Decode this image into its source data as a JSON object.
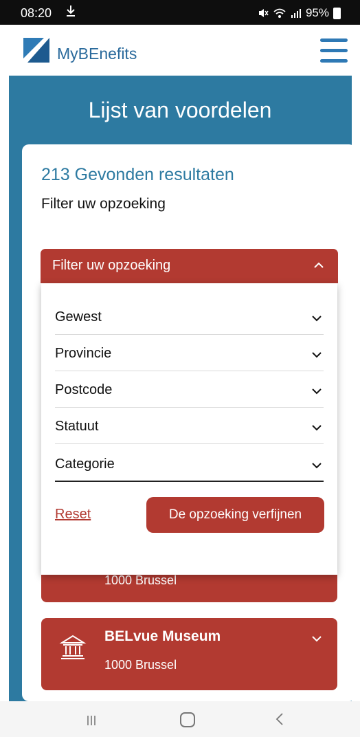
{
  "status_bar": {
    "time": "08:20",
    "download_icon": "download-icon",
    "battery": "95%",
    "icons": [
      "mute-icon",
      "wifi-icon",
      "signal-icon",
      "battery-icon"
    ]
  },
  "header": {
    "brand": "MyBEnefits",
    "logo_icon": "mybenefits-logo",
    "menu_icon": "hamburger-menu-icon"
  },
  "page": {
    "title": "Lijst van voordelen",
    "results_count": "213 Gevonden resultaten",
    "subtitle": "Filter uw opzoeking"
  },
  "filter": {
    "header_label": "Filter uw opzoeking",
    "expanded": true,
    "fields": [
      {
        "label": "Gewest"
      },
      {
        "label": "Provincie"
      },
      {
        "label": "Postcode"
      },
      {
        "label": "Statuut"
      },
      {
        "label": "Categorie"
      }
    ],
    "reset_label": "Reset",
    "refine_label": "De opzoeking verfijnen"
  },
  "results": [
    {
      "title": "",
      "city": "1000 Brussel"
    },
    {
      "title": "BELvue Museum",
      "city": "1000 Brussel",
      "icon": "museum-icon"
    }
  ],
  "nav": {
    "recent_icon": "recent-apps-icon",
    "home_icon": "home-icon",
    "back_icon": "back-icon"
  },
  "colors": {
    "primary_blue": "#2d7aa1",
    "brand_blue": "#2a6a9c",
    "accent_red": "#b23a31"
  }
}
